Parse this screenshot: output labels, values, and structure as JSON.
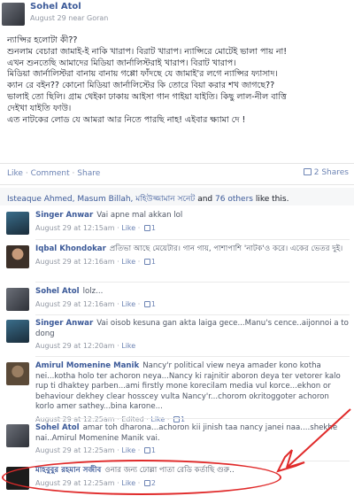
{
  "post": {
    "author": "Sohel Atol",
    "meta": "August 29 near Goran",
    "lines": [
      "ন্যাপ্সির হলোটা কী??",
      "শুনলাম বেচারা জামাই-ই নাকি খারাপ। বিরাট খারাপ। ন্যাপ্সিরে মোটেই ভালা পায় না!",
      "এখন শুনতেছি আমাদের মিডিয়া জার্নালিস্টরাই খারাপ। বিরাট খারাপ।",
      "মিডিয়া জার্নালিস্টরা বানায় বানায় গপ্পো ফাঁদছে যে জামাই'র লগে ন্যাপ্সির ফ্যাসাদ।",
      "ক্যান রে বইন?? কোনো মিডিয়া জার্নালিস্টের কি তোরে বিয়া করার শখ জাগছে??",
      "ভালাই তো ছিলি। গ্রাম থেইকা ঢাকায় আইসা গান গাইয়া যাইতি। কিছু লাল-নীল বাত্তি",
      "দেইখা যাইতি ফাউ।",
      "এত নাটকের লোড যে আমরা আর নিতে পারছি নাহ! এইবার ক্ষ্যামা দে !"
    ],
    "actions": [
      "Like",
      "Comment",
      "Share"
    ],
    "shares_label": "2 Shares",
    "likes": {
      "names": "Isteaque Ahmed, Masum Billah, মহিউজ্জামান সনেট",
      "and_text": "and",
      "others": "76 others",
      "tail": "like this."
    }
  },
  "comments": [
    {
      "name": "Singer Anwar",
      "text": "Vai apne mal akkan lol",
      "time": "August 29 at 12:15am",
      "like_label": "Like",
      "likes": "1"
    },
    {
      "name": "Iqbal Khondokar",
      "text": "প্রতিভা আছে মেয়েটার। গান গায়, পাশাপাশি 'নাটক'ও করে। একের ভেতর দুই।",
      "time": "August 29 at 12:16am",
      "like_label": "Like",
      "likes": "1"
    },
    {
      "name": "Sohel Atol",
      "text": "lolz...",
      "time": "August 29 at 12:16am",
      "like_label": "Like",
      "likes": "1"
    },
    {
      "name": "Singer Anwar",
      "text": "Vai oisob kesuna gan akta laiga gece...Manu's cence..aijonnoi a to dong",
      "time": "August 29 at 12:20am",
      "like_label": "Like",
      "likes": ""
    },
    {
      "name": "Amirul Momenine Manik",
      "text": "Nancy'r political view neya amader kono kotha nei...kotha holo ter achoron neya...Nancy ki rajnitir aboron deya ter vetorer kalo rup ti dhaktey parben...ami firstly mone korecilam media vul korce...ekhon or behaviour dekhey clear hosscey vulta Nancy'r...chorom okritoggoter achoron korlo amer sathey...bina karone...",
      "time": "August 29 at 12:25am",
      "edited": "Edited",
      "like_label": "Like",
      "likes": "1"
    },
    {
      "name": "Sohel Atol",
      "text": "amar toh dharona...achoron kii jinish taa nancy janei naa....shekhe nai..Amirul Momenine Manik vai.",
      "time": "August 29 at 12:25am",
      "like_label": "Like",
      "likes": "1"
    },
    {
      "name": "মাহবুবুর রহমান সজীব",
      "text": "ওনার জন্য ঢোল্লা পাতা রেডি কর্তাছি গুরু..",
      "time": "August 29 at 12:25am",
      "like_label": "Like",
      "likes": "2"
    }
  ],
  "colors": {
    "link": "#3b5998",
    "muted": "#9197a3",
    "highlight": "#e02a2a"
  }
}
